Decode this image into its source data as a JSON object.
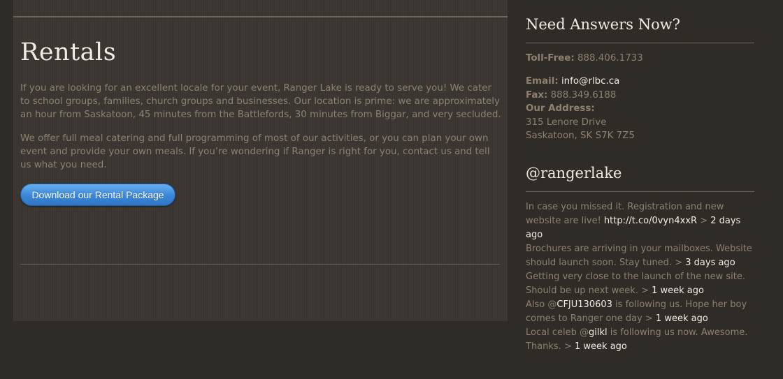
{
  "main": {
    "title": "Rentals",
    "para1": "If you are looking for an excellent locale for your event, Ranger Lake is ready to serve you! We cater to school groups, families, church groups and businesses. Our location is prime: we are approximately an hour from Saskatoon, 45 minutes from the Battlefords, 30 minutes from Biggar, and very secluded.",
    "para2": "We offer full meal catering and full programming of most of our activities, or you can plan your own event and provide your own meals. If you’re wondering if Ranger is right for you, contact us and tell us what you need.",
    "download_button": "Download our Rental Package"
  },
  "contact": {
    "heading": "Need Answers Now?",
    "tollfree_label": "Toll-Free:",
    "tollfree_value": "888.406.1733",
    "email_label": "Email:",
    "email_value": "info@rlbc.ca",
    "fax_label": "Fax:",
    "fax_value": "888.349.6188",
    "address_label": "Our Address:",
    "address_line1": "315 Lenore Drive",
    "address_line2": "Saskatoon, SK S7K 7Z5"
  },
  "twitter": {
    "heading": "@rangerlake",
    "tweets": [
      {
        "text": "In case you missed it. Registration and new website are live!",
        "link": "http://t.co/0vyn4xxR",
        "sep": ">",
        "ago": "2 days ago"
      },
      {
        "text": "Brochures are arriving in your mailboxes. Website should launch soon. Stay tuned.",
        "sep": ">",
        "ago": "3 days ago"
      },
      {
        "text": "Getting very close to the launch of the new site. Should be up next week.",
        "sep": ">",
        "ago": "1 week ago"
      },
      {
        "pre": "Also @",
        "mention": "CFJU130603",
        "text": "is following us. Hope her boy comes to Ranger one day",
        "sep": ">",
        "ago": "1 week ago"
      },
      {
        "pre": "Local celeb @",
        "mention": "gilkl",
        "text": "is following us now. Awesome. Thanks.",
        "sep": ">",
        "ago": "1 week ago"
      }
    ]
  },
  "colors": {
    "background": "#2e2a25",
    "panel": "#3a3530",
    "body_text": "#8d8270",
    "heading_text": "#f1ece2",
    "button": "#3a86d6"
  }
}
